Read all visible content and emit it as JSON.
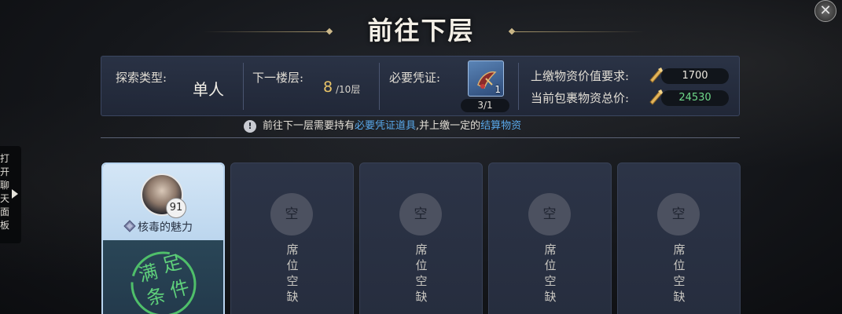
{
  "title": "前往下层",
  "close_icon": "close-icon",
  "info": {
    "type_label": "探索类型:",
    "type_value": "单人",
    "floor_label": "下一楼层:",
    "floor_current": "8",
    "floor_total": "/10层",
    "credential_label": "必要凭证:",
    "credential_item_icon": "token-item-icon",
    "credential_item_count": "1",
    "credential_need": "3/1",
    "requirement_label": "上缴物资价值要求:",
    "requirement_value": "1700",
    "total_label": "当前包裹物资总价:",
    "total_value": "24530",
    "total_color": "#6fd98a"
  },
  "notice": {
    "prefix": "前往下一层需要持有",
    "highlight1": "必要凭证道具",
    "middle": ",并上缴一定的",
    "highlight2": "结算物资",
    "highlight_color": "#59a8ea"
  },
  "side_tab": {
    "label": "打开聊天面板"
  },
  "seats": {
    "filled": {
      "level": "91",
      "name": "核毒的魅力",
      "stamp_text": "满足条件"
    },
    "empty": [
      {
        "circle": "空",
        "text": "席位空缺"
      },
      {
        "circle": "空",
        "text": "席位空缺"
      },
      {
        "circle": "空",
        "text": "席位空缺"
      },
      {
        "circle": "空",
        "text": "席位空缺"
      }
    ]
  }
}
